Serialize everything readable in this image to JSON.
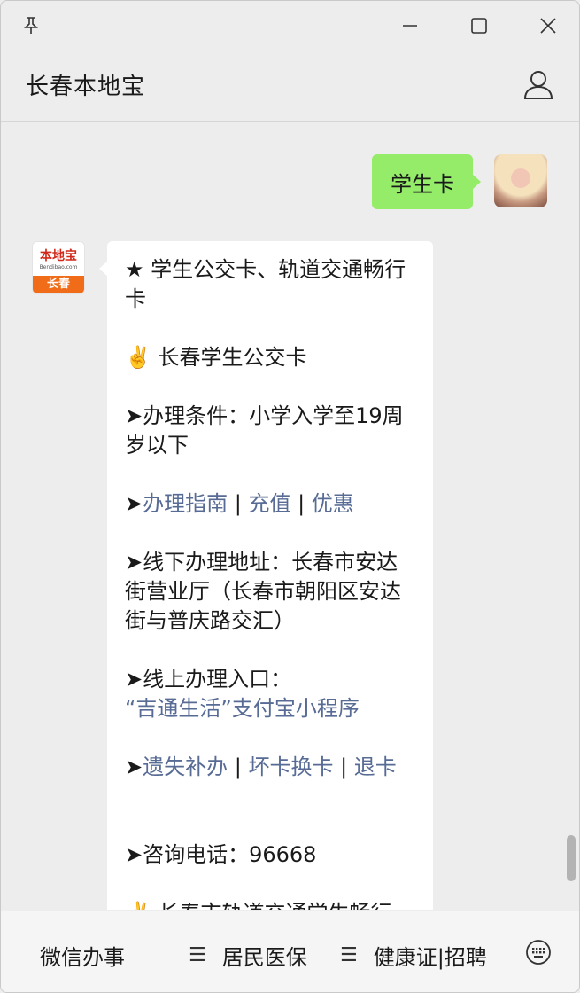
{
  "chat": {
    "title": "长春本地宝"
  },
  "outgoing_message": {
    "text": "学生卡"
  },
  "bot_avatar": {
    "logo_text": "本地宝",
    "logo_sub": "Bendibao.com",
    "city": "长春"
  },
  "reply": {
    "title": "★ 学生公交卡、轨道交通畅行卡",
    "section1_title": "✌️ 长春学生公交卡",
    "conditions": "➤办理条件：小学入学至19周岁以下",
    "links1": {
      "arrow": "➤",
      "guide": "办理指南",
      "sep1": " | ",
      "recharge": "充值",
      "sep2": " | ",
      "discount": "优惠"
    },
    "offline_address": "➤线下办理地址：长春市安达街营业厅（长春市朝阳区安达街与普庆路交汇）",
    "online_label": "➤线上办理入口：",
    "online_link": "“吉通生活”支付宝小程序",
    "links2": {
      "arrow": "➤",
      "lost": "遗失补办",
      "sep1": " | ",
      "broken": "坏卡换卡",
      "sep2": " | ",
      "refund": "退卡"
    },
    "phone": "➤咨询电话：96668",
    "section2_partial": "✌️ 长春市轨道交通学生畅行"
  },
  "bottom_menu": {
    "item1": "微信办事",
    "item2": "居民医保",
    "item3": "健康证|招聘"
  },
  "colors": {
    "outgoing_bubble": "#95ec69",
    "link": "#576b95",
    "background": "#ededed"
  }
}
